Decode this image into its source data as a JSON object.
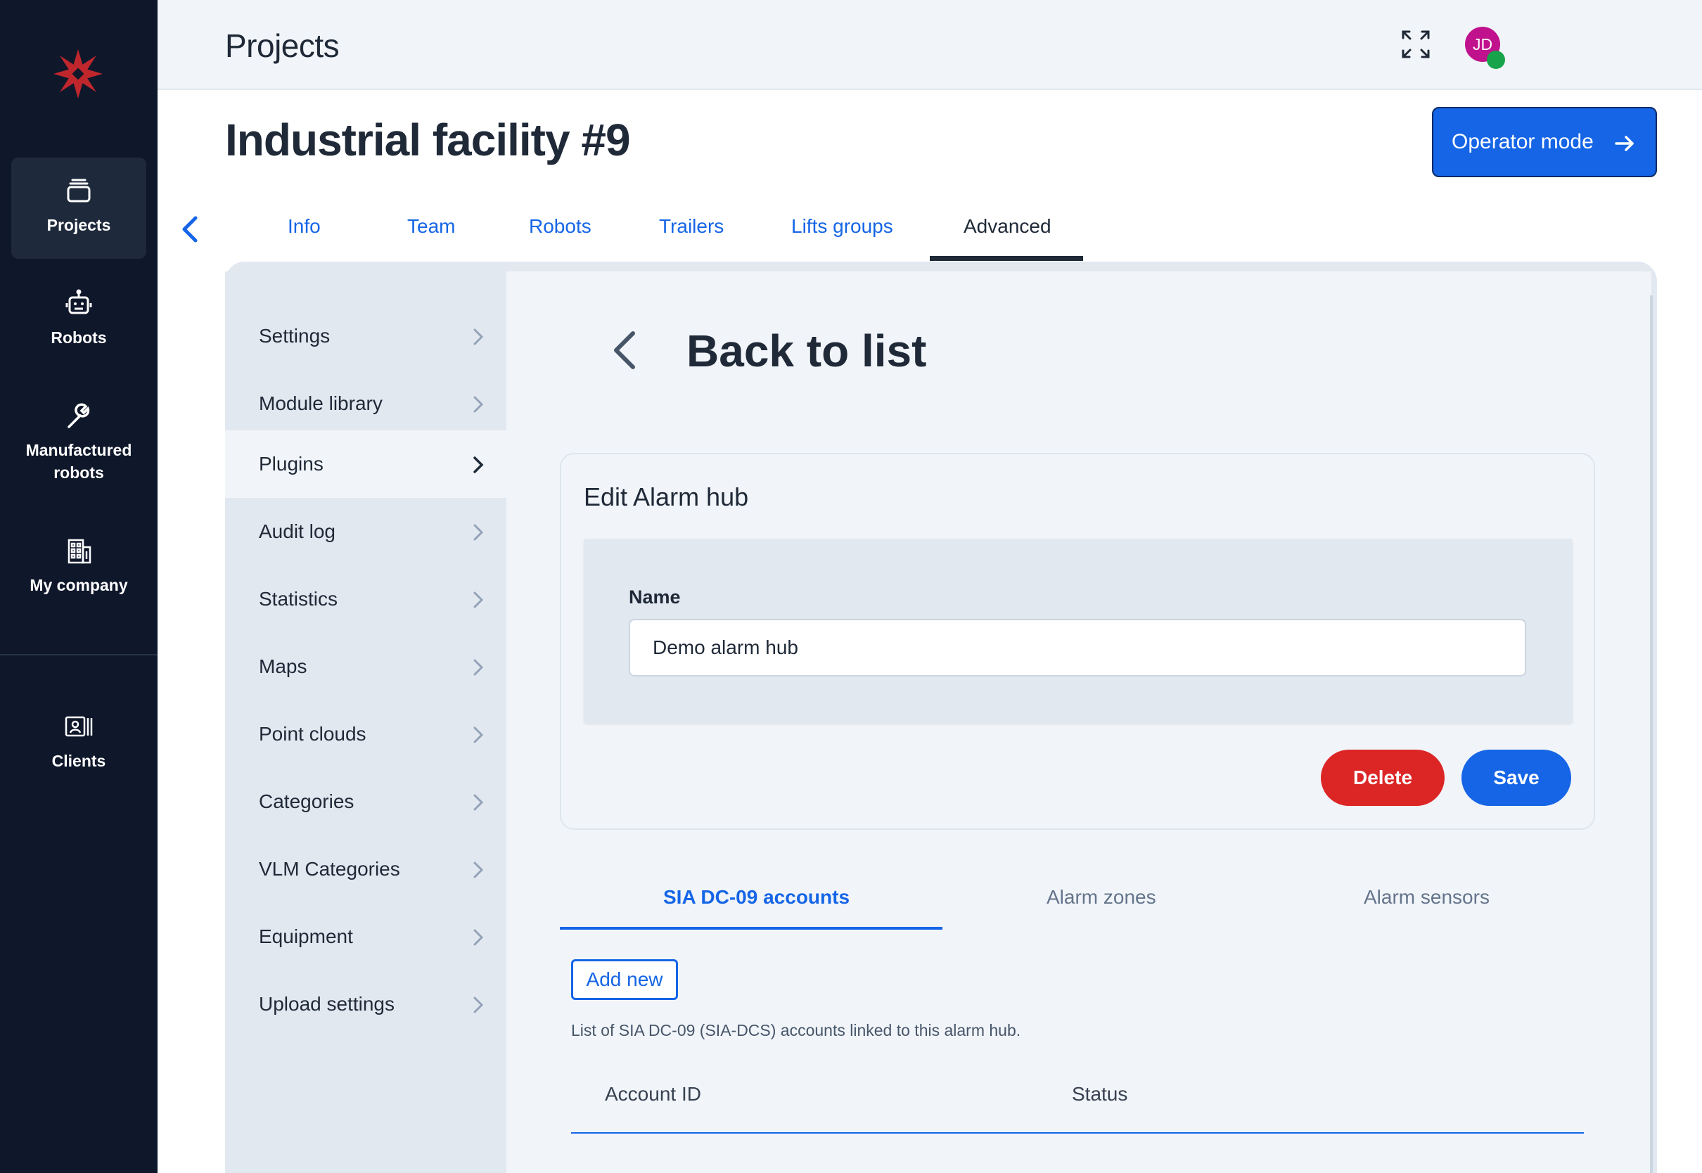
{
  "header": {
    "title": "Projects",
    "avatar_initials": "JD"
  },
  "sidebar": {
    "items": [
      {
        "label": "Projects",
        "icon": "projects-stack-icon",
        "active": true
      },
      {
        "label": "Robots",
        "icon": "robot-icon",
        "active": false
      },
      {
        "label": "Manufactured robots",
        "icon": "wrench-icon",
        "active": false
      },
      {
        "label": "My company",
        "icon": "building-icon",
        "active": false
      },
      {
        "label": "Clients",
        "icon": "contact-card-icon",
        "active": false
      }
    ]
  },
  "page": {
    "title": "Industrial facility #9",
    "operator_mode_label": "Operator mode"
  },
  "tabs": [
    {
      "label": "Info",
      "active": false
    },
    {
      "label": "Team",
      "active": false
    },
    {
      "label": "Robots",
      "active": false
    },
    {
      "label": "Trailers",
      "active": false
    },
    {
      "label": "Lifts groups",
      "active": false
    },
    {
      "label": "Advanced",
      "active": true
    }
  ],
  "submenu": [
    {
      "label": "Settings",
      "active": false
    },
    {
      "label": "Module library",
      "active": false
    },
    {
      "label": "Plugins",
      "active": true
    },
    {
      "label": "Audit log",
      "active": false
    },
    {
      "label": "Statistics",
      "active": false
    },
    {
      "label": "Maps",
      "active": false
    },
    {
      "label": "Point clouds",
      "active": false
    },
    {
      "label": "Categories",
      "active": false
    },
    {
      "label": "VLM Categories",
      "active": false
    },
    {
      "label": "Equipment",
      "active": false
    },
    {
      "label": "Upload settings",
      "active": false
    }
  ],
  "detail": {
    "back_label": "Back to list",
    "edit_title": "Edit Alarm hub",
    "name_label": "Name",
    "name_value": "Demo alarm hub",
    "delete_label": "Delete",
    "save_label": "Save",
    "sub_tabs": [
      {
        "label": "SIA DC-09 accounts",
        "active": true
      },
      {
        "label": "Alarm zones",
        "active": false
      },
      {
        "label": "Alarm sensors",
        "active": false
      }
    ],
    "add_new_label": "Add new",
    "accounts_description": "List of SIA DC-09 (SIA-DCS) accounts linked to this alarm hub.",
    "table_columns": [
      "Account ID",
      "Status"
    ]
  },
  "colors": {
    "sidebar_bg": "#0f172a",
    "accent_blue": "#1565e6",
    "danger_red": "#dc2626",
    "logo_red": "#c0272d",
    "avatar_bg": "#c0128c",
    "status_online": "#16a34a"
  }
}
